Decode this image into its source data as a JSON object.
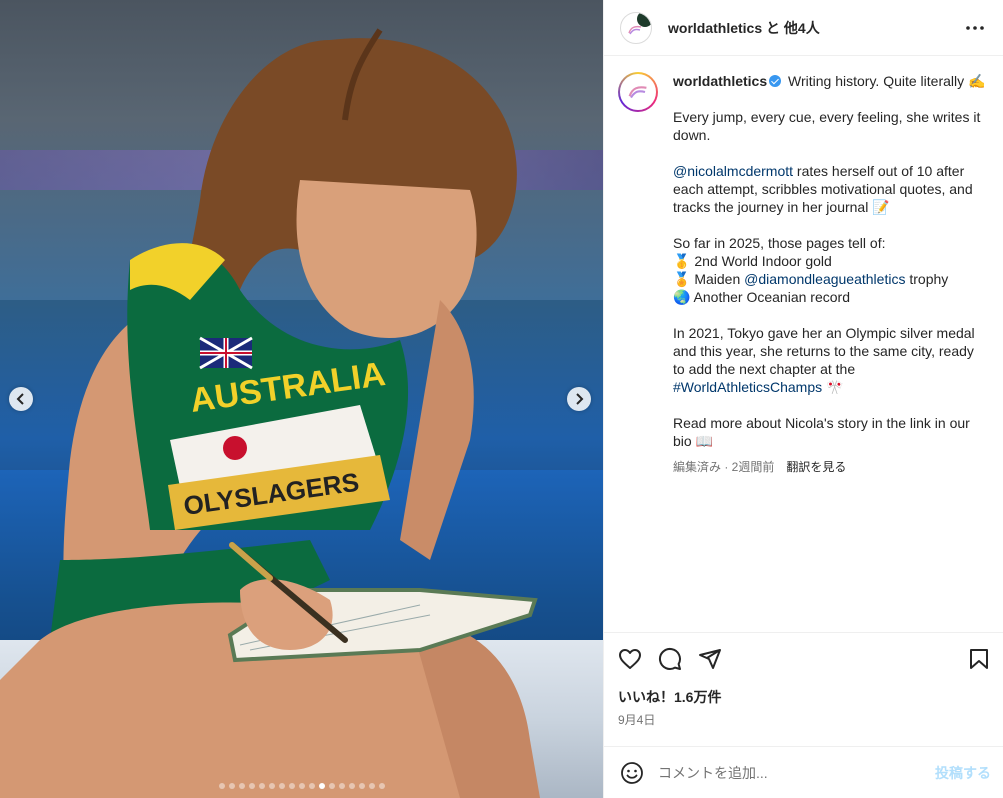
{
  "header": {
    "username": "worldathletics",
    "coauthors": " と 他4人"
  },
  "caption": {
    "username": "worldathletics",
    "headline": "Writing history. Quite literally ✍️",
    "p1": "Every jump, every cue, every feeling, she writes it down.",
    "p2_mention": "@nicolalmcdermott",
    "p2_text": " rates herself out of 10 after each attempt, scribbles motivational quotes, and tracks the journey in her journal 📝",
    "p3_intro": "So far in 2025, those pages tell of:",
    "p3_line1": "🥇 2nd World Indoor gold",
    "p3_line2_pre": "🏅 Maiden ",
    "p3_line2_link": "@diamondleagueathletics",
    "p3_line2_post": " trophy",
    "p3_line3": "🌏 Another Oceanian record",
    "p4_text": "In 2021, Tokyo gave her an Olympic silver medal and this year, she returns to the same city, ready to add the next chapter at the ",
    "p4_hashtag": "#WorldAthleticsChamps",
    "p4_emoji": " 🎌",
    "p5": "Read more about Nicola's story in the link in our bio 📖",
    "meta_edited": "編集済み · 2週間前",
    "meta_translate": "翻訳を見る"
  },
  "actions": {
    "likes": "いいね！1.6万件",
    "date": "9月4日"
  },
  "comment": {
    "placeholder": "コメントを追加...",
    "post_label": "投稿する"
  },
  "carousel": {
    "total": 17,
    "active_index": 10
  },
  "photo": {
    "jersey_text": "AUSTRALIA",
    "bib_name": "OLYSLAGERS"
  },
  "colors": {
    "link": "#00376b",
    "verified": "#3897f0",
    "post_disabled": "#b2dffc",
    "jersey_green": "#0b6b3f",
    "jersey_gold": "#f2d12a"
  },
  "icons": [
    "more-icon",
    "chevron-left-icon",
    "chevron-right-icon",
    "heart-icon",
    "comment-icon",
    "share-icon",
    "bookmark-icon",
    "emoji-icon",
    "verified-badge-icon"
  ]
}
